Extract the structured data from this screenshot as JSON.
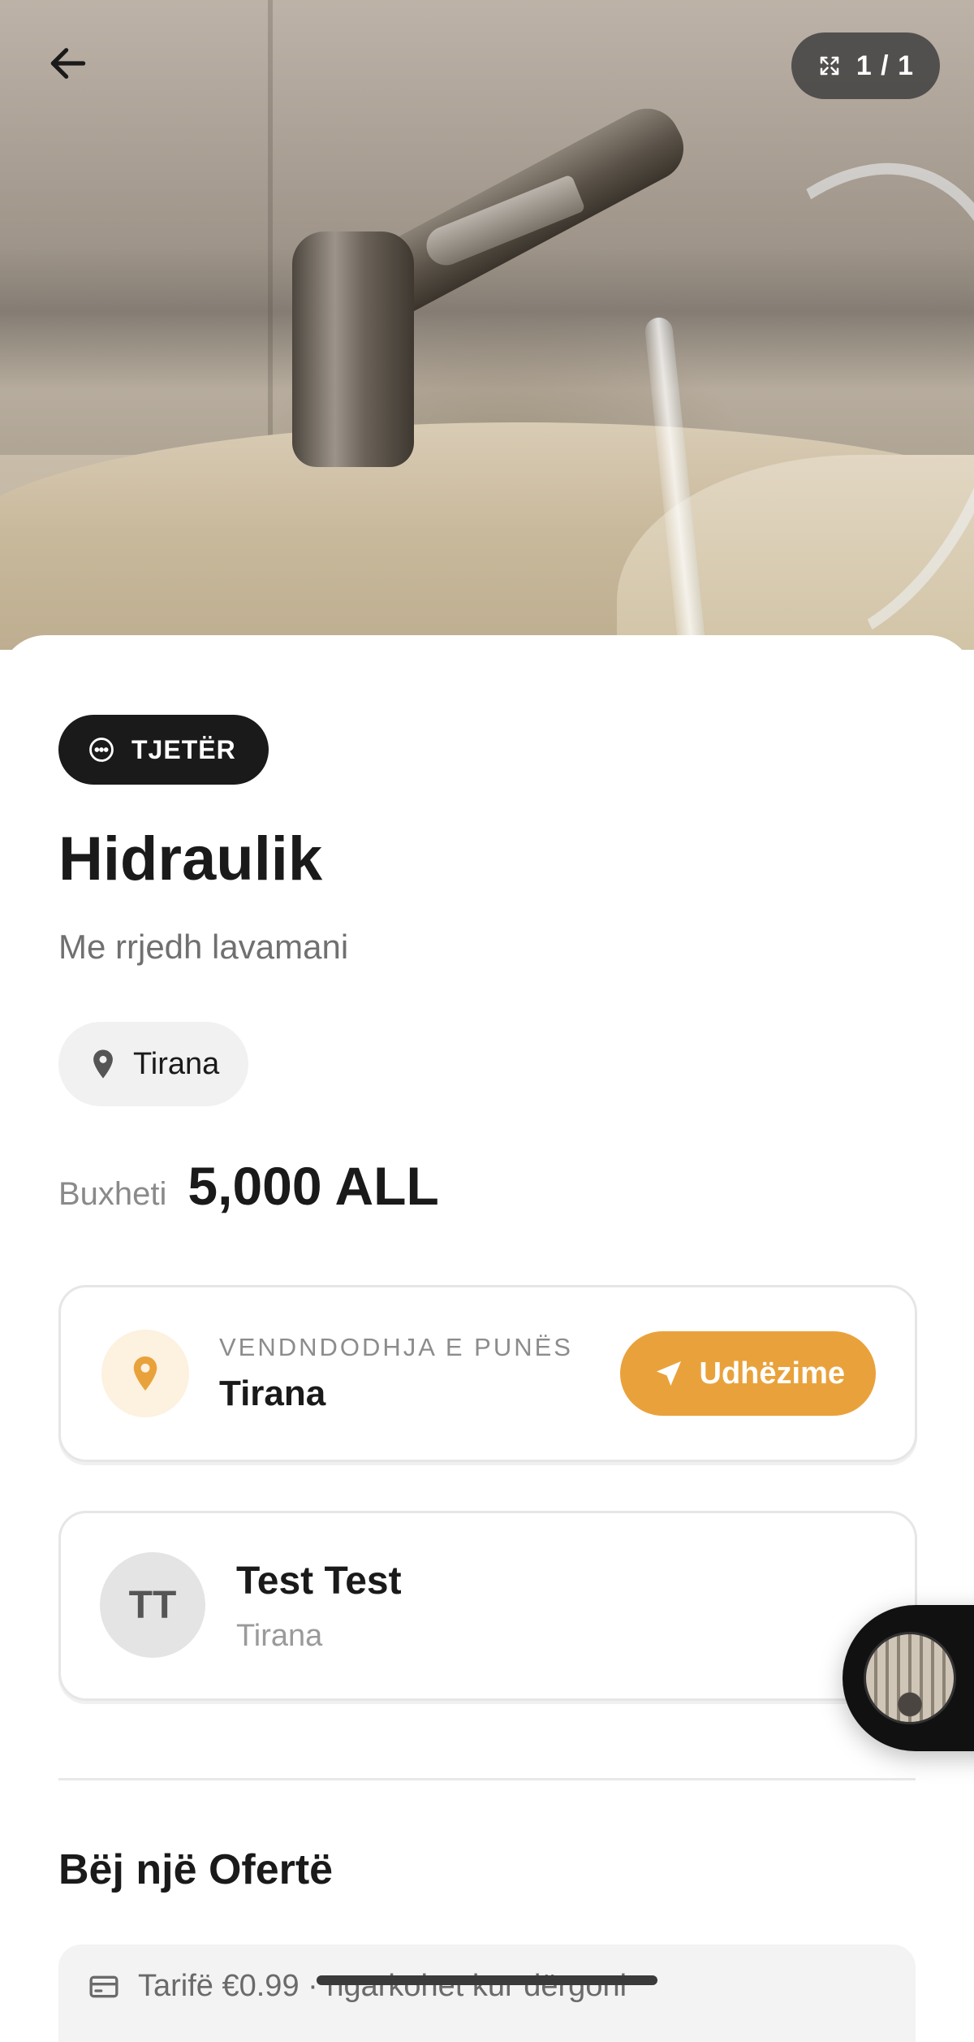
{
  "header": {
    "back_icon": "arrow-left-icon",
    "expand_icon": "expand-icon",
    "image_counter": "1 / 1"
  },
  "listing": {
    "category_icon": "more-horizontal-circle-icon",
    "category": "TJETËR",
    "title": "Hidraulik",
    "description": "Me rrjedh lavamani",
    "location_chip": "Tirana",
    "budget_label": "Buxheti",
    "budget_value": "5,000 ALL"
  },
  "job_location": {
    "label": "VENDNDODHJA E PUNËS",
    "value": "Tirana",
    "directions_label": "Udhëzime",
    "accent": "#E9A23B"
  },
  "user": {
    "initials": "TT",
    "name": "Test Test",
    "city": "Tirana"
  },
  "offer": {
    "heading": "Bëj një Ofertë",
    "fee_text": "Tarifë €0.99 · ngarkohet kur dërgoni"
  }
}
